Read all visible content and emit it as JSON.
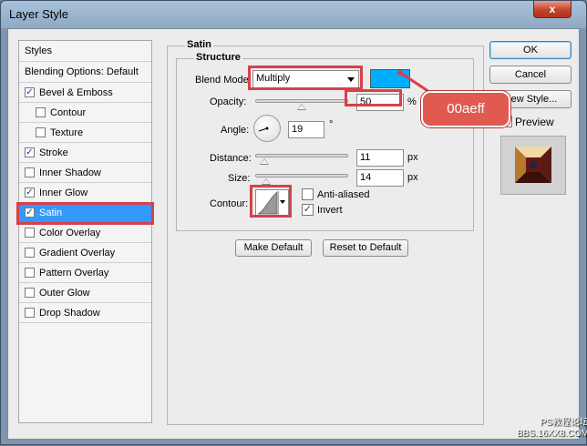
{
  "window": {
    "title": "Layer Style",
    "close_glyph": "x"
  },
  "styles_list": {
    "header": "Styles",
    "blending_options": "Blending Options: Default",
    "items": [
      {
        "label": "Bevel & Emboss",
        "checked": true,
        "indent": false
      },
      {
        "label": "Contour",
        "checked": false,
        "indent": true
      },
      {
        "label": "Texture",
        "checked": false,
        "indent": true
      },
      {
        "label": "Stroke",
        "checked": true,
        "indent": false
      },
      {
        "label": "Inner Shadow",
        "checked": false,
        "indent": false
      },
      {
        "label": "Inner Glow",
        "checked": true,
        "indent": false
      },
      {
        "label": "Satin",
        "checked": true,
        "indent": false,
        "selected": true
      },
      {
        "label": "Color Overlay",
        "checked": false,
        "indent": false
      },
      {
        "label": "Gradient Overlay",
        "checked": false,
        "indent": false
      },
      {
        "label": "Pattern Overlay",
        "checked": false,
        "indent": false
      },
      {
        "label": "Outer Glow",
        "checked": false,
        "indent": false
      },
      {
        "label": "Drop Shadow",
        "checked": false,
        "indent": false
      }
    ]
  },
  "satin": {
    "group_title": "Satin",
    "structure_title": "Structure",
    "blend_mode_label": "Blend Mode:",
    "blend_mode_value": "Multiply",
    "color": "#00aeff",
    "opacity_label": "Opacity:",
    "opacity_value": "50",
    "opacity_unit": "%",
    "opacity_fraction": 0.5,
    "angle_label": "Angle:",
    "angle_value": "19",
    "angle_unit": "°",
    "distance_label": "Distance:",
    "distance_value": "11",
    "distance_unit": "px",
    "size_label": "Size:",
    "size_value": "14",
    "size_unit": "px",
    "contour_label": "Contour:",
    "anti_aliased_label": "Anti-aliased",
    "anti_aliased_checked": false,
    "invert_label": "Invert",
    "invert_checked": true,
    "make_default": "Make Default",
    "reset_default": "Reset to Default"
  },
  "buttons": {
    "ok": "OK",
    "cancel": "Cancel",
    "new_style": "New Style...",
    "preview_label": "Preview",
    "preview_checked": true
  },
  "annotation": {
    "callout_text": "00aeff",
    "highlight_color": "#d6414a"
  },
  "watermark": {
    "line1": "PS教程论坛",
    "line2": "BBS.16XX8.COM"
  }
}
